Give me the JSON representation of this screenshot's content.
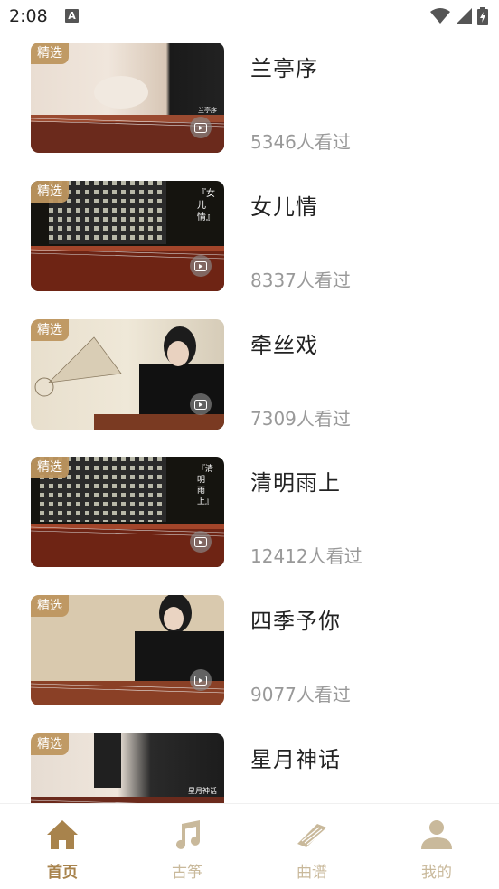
{
  "status": {
    "time": "2:08",
    "notif": "A"
  },
  "badge_label": "精选",
  "videos": [
    {
      "title": "兰亭序",
      "views": "5346人看过",
      "thumb_text": "兰亭序"
    },
    {
      "title": "女儿情",
      "views": "8337人看过",
      "thumb_text": "『女儿情』"
    },
    {
      "title": "牵丝戏",
      "views": "7309人看过",
      "thumb_text": ""
    },
    {
      "title": "清明雨上",
      "views": "12412人看过",
      "thumb_text": "『清明雨上』"
    },
    {
      "title": "四季予你",
      "views": "9077人看过",
      "thumb_text": ""
    },
    {
      "title": "星月神话",
      "views": "",
      "thumb_text": "星月神话"
    }
  ],
  "nav": [
    {
      "label": "首页",
      "icon": "home-icon",
      "active": true
    },
    {
      "label": "古筝",
      "icon": "music-note-icon",
      "active": false
    },
    {
      "label": "曲谱",
      "icon": "sheet-music-icon",
      "active": false
    },
    {
      "label": "我的",
      "icon": "user-icon",
      "active": false
    }
  ],
  "colors": {
    "accent": "#a8834c",
    "inactive": "#c9b99b",
    "badge": "#be965f"
  }
}
